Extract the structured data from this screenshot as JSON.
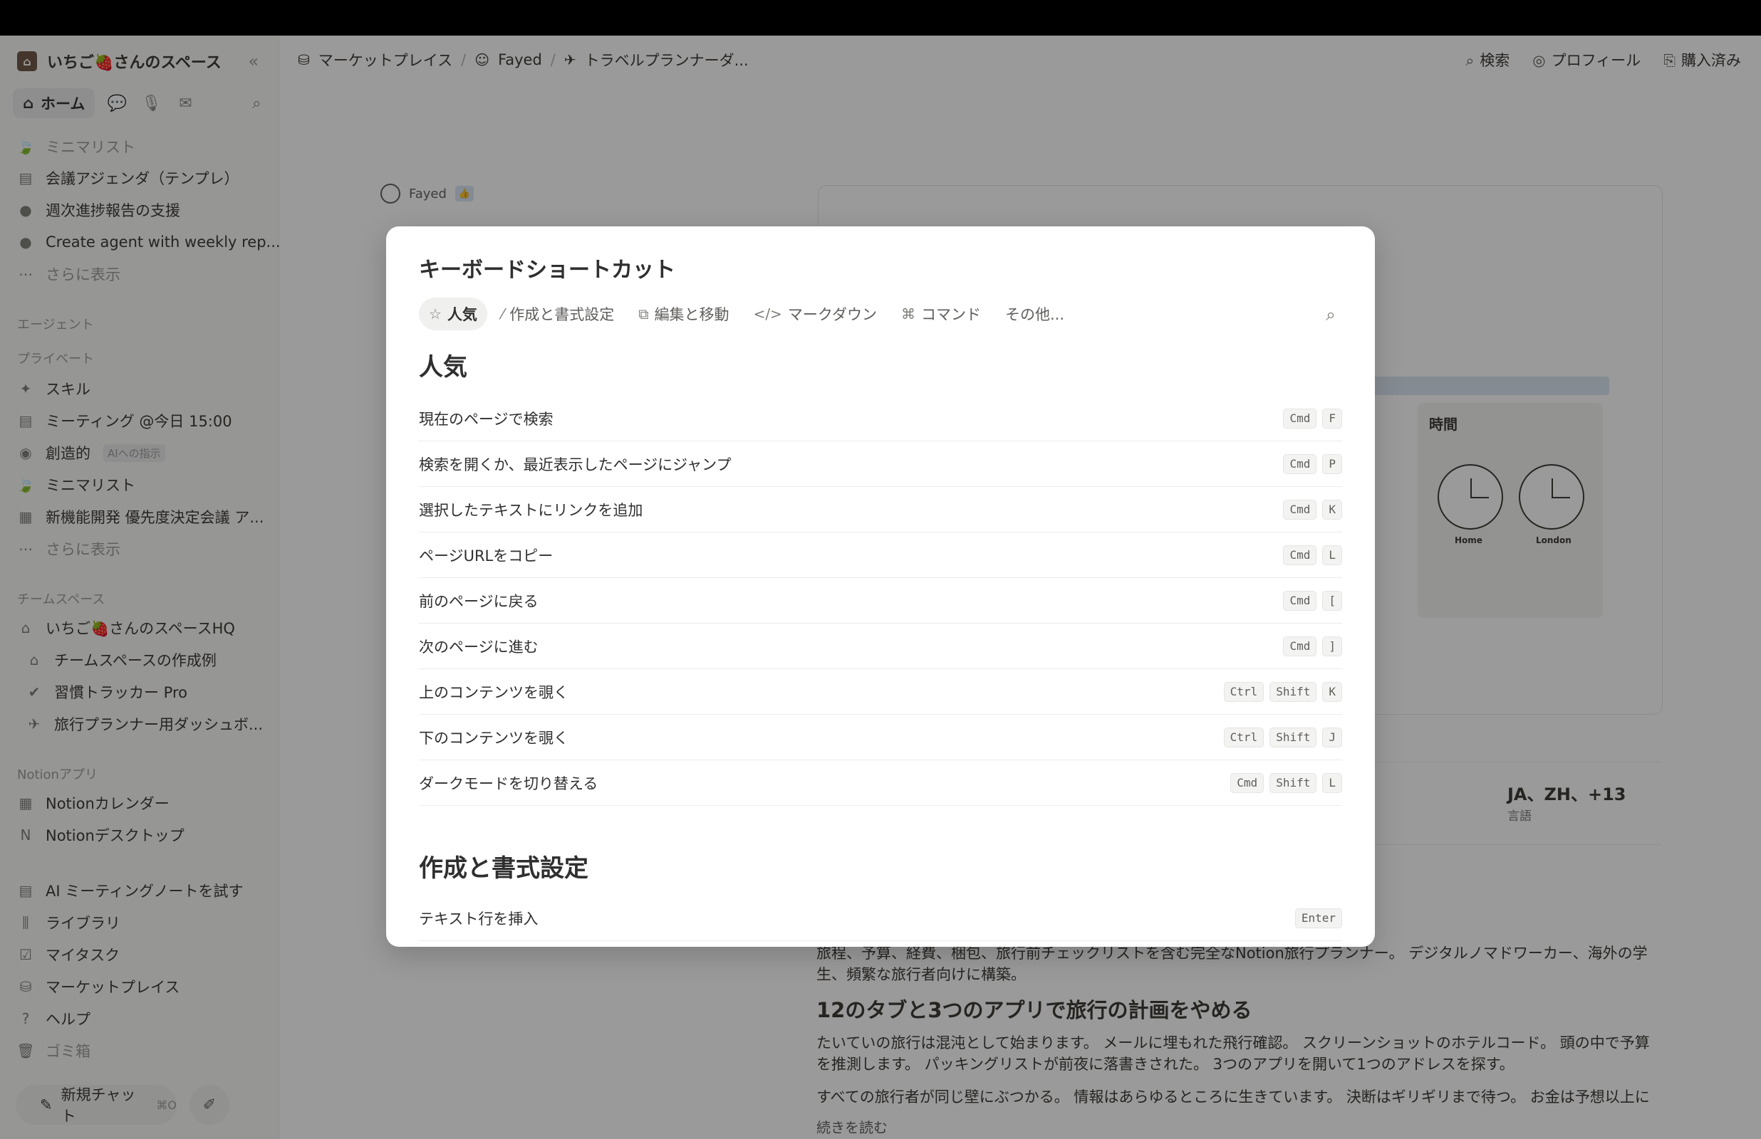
{
  "sidebar": {
    "workspace": "いちご🍓さんのスペース",
    "nav": {
      "home": "ホーム"
    },
    "recent": [
      {
        "icon": "leaf",
        "label": "ミニマリスト"
      },
      {
        "icon": "page",
        "label": "会議アジェンダ（テンプレ）"
      },
      {
        "icon": "agent",
        "label": "週次進捗報告の支援"
      },
      {
        "icon": "agent",
        "label": "Create agent with weekly rep..."
      },
      {
        "icon": "more",
        "label": "さらに表示"
      }
    ],
    "agents_section": "エージェント",
    "private_section": "プライベート",
    "private": [
      {
        "icon": "wand",
        "label": "スキル"
      },
      {
        "icon": "page",
        "label": "ミーティング @今日 15:00"
      },
      {
        "icon": "palette",
        "label": "創造的",
        "tag": "AIへの指示"
      },
      {
        "icon": "leaf",
        "label": "ミニマリスト"
      },
      {
        "icon": "box",
        "label": "新機能開発 優先度決定会議 ア..."
      },
      {
        "icon": "more",
        "label": "さらに表示"
      }
    ],
    "teamspace_section": "チームスペース",
    "teamspace": [
      {
        "icon": "house",
        "label": "いちご🍓さんのスペースHQ"
      },
      {
        "icon": "house2",
        "label": "チームスペースの作成例"
      },
      {
        "icon": "badge",
        "label": "習慣トラッカー Pro"
      },
      {
        "icon": "plane",
        "label": "旅行プランナー用ダッシュボ..."
      }
    ],
    "apps_section": "Notionアプリ",
    "apps": [
      {
        "icon": "calendar",
        "label": "Notionカレンダー"
      },
      {
        "icon": "notion",
        "label": "Notionデスクトップ"
      }
    ],
    "tools": [
      {
        "icon": "meeting",
        "label": "AI ミーティングノートを試す"
      },
      {
        "icon": "library",
        "label": "ライブラリ"
      },
      {
        "icon": "check",
        "label": "マイタスク"
      },
      {
        "icon": "market",
        "label": "マーケットプレイス"
      },
      {
        "icon": "help",
        "label": "ヘルプ"
      },
      {
        "icon": "trash",
        "label": "ゴミ箱"
      }
    ],
    "new_chat": "新規チャット",
    "new_chat_kbd": "⌘O"
  },
  "header": {
    "breadcrumbs": [
      "マーケットプレイス",
      "Fayed",
      "トラベルプランナーダ..."
    ],
    "search": "検索",
    "profile": "プロフィール",
    "purchased": "購入済み"
  },
  "background": {
    "author": "Fayed",
    "time_title": "時間",
    "clock_home": "Home",
    "clock_london": "London",
    "languages": "JA、ZH、+13",
    "languages_label": "言語",
    "description": "旅程、予算、経費、梱包、旅行前チェックリストを含む完全なNotion旅行プランナー。 デジタルノマドワーカー、海外の学生、頻繁な旅行者向けに構築。",
    "heading": "12のタブと3つのアプリで旅行の計画をやめる",
    "paragraph": "たいていの旅行は混沌として始まります。 メールに埋もれた飛行確認。 スクリーンショットのホテルコード。 頭の中で予算を推測します。 パッキングリストが前夜に落書きされた。 3つのアプリを開いて1つのアドレスを探す。",
    "paragraph2": "すべての旅行者が同じ壁にぶつかる。 情報はあらゆるところに生きています。 決断はギリギリまで待つ。 お金は予想以上に早く消",
    "read_more": "続きを読む"
  },
  "modal": {
    "title": "キーボードショートカット",
    "tabs": [
      {
        "icon": "star",
        "label": "人気"
      },
      {
        "icon": "pencil",
        "label": "作成と書式設定"
      },
      {
        "icon": "copy",
        "label": "編集と移動"
      },
      {
        "icon": "code",
        "label": "マークダウン"
      },
      {
        "icon": "command",
        "label": "コマンド"
      },
      {
        "icon": "",
        "label": "その他..."
      }
    ],
    "section1": "人気",
    "shortcuts": [
      {
        "label": "現在のページで検索",
        "keys": [
          "Cmd",
          "F"
        ]
      },
      {
        "label": "検索を開くか、最近表示したページにジャンプ",
        "keys": [
          "Cmd",
          "P"
        ]
      },
      {
        "label": "選択したテキストにリンクを追加",
        "keys": [
          "Cmd",
          "K"
        ]
      },
      {
        "label": "ページURLをコピー",
        "keys": [
          "Cmd",
          "L"
        ]
      },
      {
        "label": "前のページに戻る",
        "keys": [
          "Cmd",
          "["
        ]
      },
      {
        "label": "次のページに進む",
        "keys": [
          "Cmd",
          "]"
        ]
      },
      {
        "label": "上のコンテンツを覗く",
        "keys": [
          "Ctrl",
          "Shift",
          "K"
        ]
      },
      {
        "label": "下のコンテンツを覗く",
        "keys": [
          "Ctrl",
          "Shift",
          "J"
        ]
      },
      {
        "label": "ダークモードを切り替える",
        "keys": [
          "Cmd",
          "Shift",
          "L"
        ]
      }
    ],
    "section2": "作成と書式設定",
    "shortcuts2": [
      {
        "label": "テキスト行を挿入",
        "keys": [
          "Enter"
        ]
      }
    ]
  },
  "colors": {
    "overlay": "#0f0f0f",
    "accent": "#2f6eb5"
  }
}
